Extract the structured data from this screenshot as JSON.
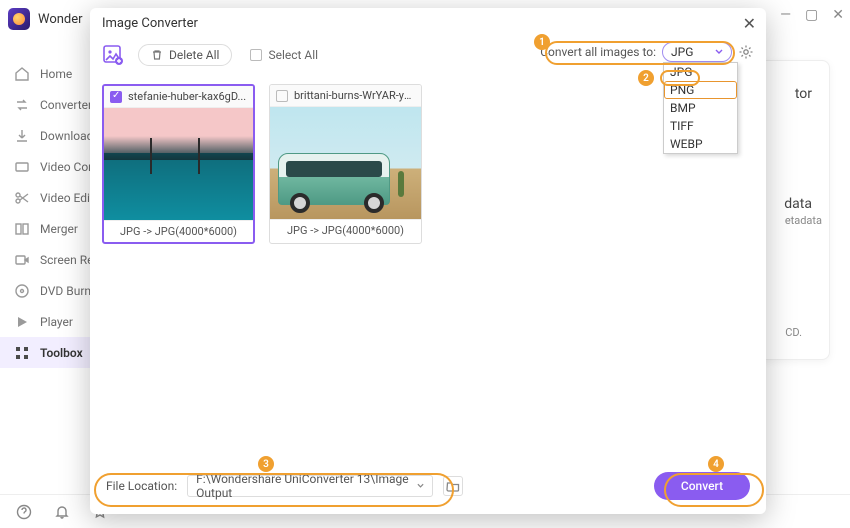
{
  "app": {
    "title": "Wonder"
  },
  "win": {
    "min": "—",
    "max": "▢",
    "close": "✕"
  },
  "sidebar": {
    "items": [
      {
        "label": "Home",
        "icon": "home"
      },
      {
        "label": "Converter",
        "icon": "convert"
      },
      {
        "label": "Downloader",
        "icon": "download"
      },
      {
        "label": "Video Compressor",
        "icon": "compress"
      },
      {
        "label": "Video Editor",
        "icon": "scissors"
      },
      {
        "label": "Merger",
        "icon": "merge"
      },
      {
        "label": "Screen Recorder",
        "icon": "record"
      },
      {
        "label": "DVD Burner",
        "icon": "dvd"
      },
      {
        "label": "Player",
        "icon": "play"
      },
      {
        "label": "Toolbox",
        "icon": "grid"
      }
    ]
  },
  "bg": {
    "t1": "tor",
    "t2": "data",
    "t3": "etadata",
    "t4": "CD."
  },
  "modal": {
    "title": "Image Converter",
    "delete_all": "Delete All",
    "select_all": "Select All",
    "convert_label": "Convert all images to:",
    "format_selected": "JPG",
    "formats": [
      "JPG",
      "PNG",
      "BMP",
      "TIFF",
      "WEBP"
    ],
    "file_location_label": "File Location:",
    "file_location_value": "F:\\Wondershare UniConverter 13\\Image Output",
    "convert": "Convert"
  },
  "cards": [
    {
      "name": "stefanie-huber-kax6gD...",
      "conv": "JPG -> JPG(4000*6000)",
      "selected": true
    },
    {
      "name": "brittani-burns-WrYAR-yD...",
      "conv": "JPG -> JPG(4000*6000)",
      "selected": false
    }
  ],
  "badges": {
    "1": "1",
    "2": "2",
    "3": "3",
    "4": "4"
  }
}
